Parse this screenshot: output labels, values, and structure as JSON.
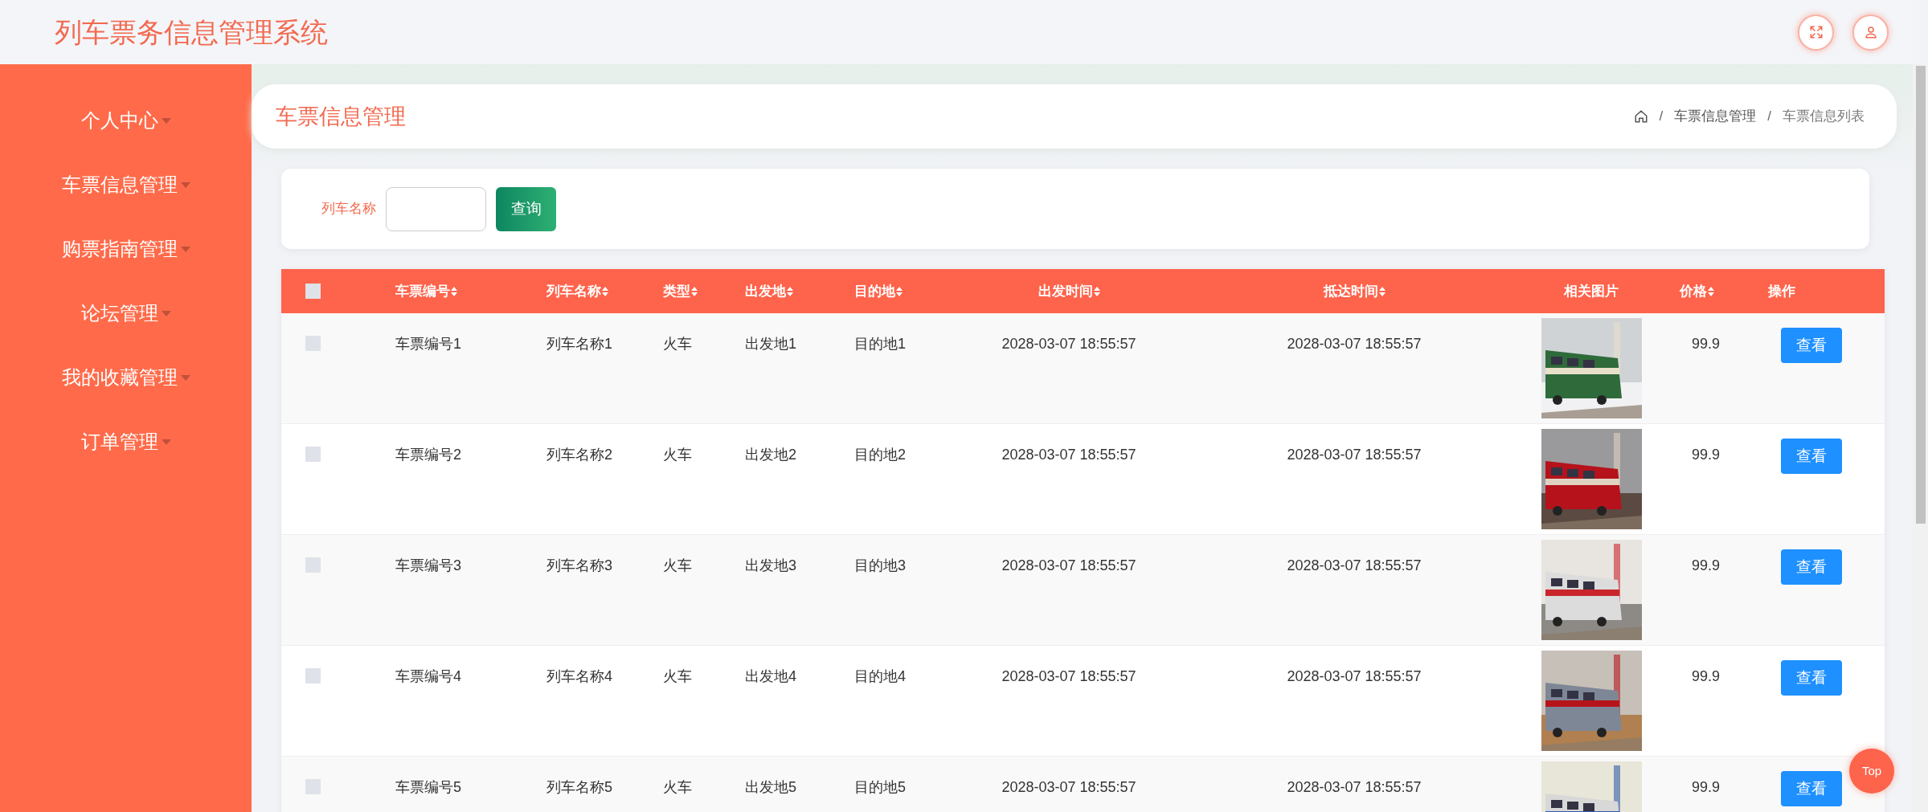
{
  "header": {
    "title": "列车票务信息管理系统"
  },
  "sidebar": {
    "items": [
      {
        "label": "个人中心",
        "expanded": false
      },
      {
        "label": "车票信息管理",
        "expanded": false
      },
      {
        "label": "购票指南管理",
        "expanded": false
      },
      {
        "label": "论坛管理",
        "expanded": false
      },
      {
        "label": "我的收藏管理",
        "expanded": false
      },
      {
        "label": "订单管理",
        "expanded": false
      }
    ]
  },
  "page_title": "车票信息管理",
  "breadcrumb": [
    {
      "kind": "home"
    },
    {
      "kind": "separator",
      "text": "/"
    },
    {
      "kind": "link",
      "text": "车票信息管理"
    },
    {
      "kind": "separator",
      "text": "/"
    },
    {
      "kind": "current",
      "text": "车票信息列表"
    }
  ],
  "search": {
    "label": "列车名称",
    "button": "查询"
  },
  "table": {
    "select_all": {
      "checked": false
    },
    "columns": [
      {
        "label": "车票编号",
        "sortable": true
      },
      {
        "label": "列车名称",
        "sortable": true
      },
      {
        "label": "类型",
        "sortable": true
      },
      {
        "label": "出发地",
        "sortable": true
      },
      {
        "label": "目的地",
        "sortable": true
      },
      {
        "label": "出发时间",
        "sortable": true
      },
      {
        "label": "抵达时间",
        "sortable": true
      },
      {
        "label": "相关图片",
        "sortable": false
      },
      {
        "label": "价格",
        "sortable": true
      },
      {
        "label": "操作",
        "sortable": false
      }
    ],
    "rows": [
      {
        "checked": false,
        "cells": [
          "车票编号1",
          "列车名称1",
          "火车",
          "出发地1",
          "目的地1",
          "2028-03-07 18:55:57",
          "2028-03-07 18:55:57"
        ],
        "price": "99.9",
        "action": "查看"
      },
      {
        "checked": false,
        "cells": [
          "车票编号2",
          "列车名称2",
          "火车",
          "出发地2",
          "目的地2",
          "2028-03-07 18:55:57",
          "2028-03-07 18:55:57"
        ],
        "price": "99.9",
        "action": "查看"
      },
      {
        "checked": false,
        "cells": [
          "车票编号3",
          "列车名称3",
          "火车",
          "出发地3",
          "目的地3",
          "2028-03-07 18:55:57",
          "2028-03-07 18:55:57"
        ],
        "price": "99.9",
        "action": "查看"
      },
      {
        "checked": false,
        "cells": [
          "车票编号4",
          "列车名称4",
          "火车",
          "出发地4",
          "目的地4",
          "2028-03-07 18:55:57",
          "2028-03-07 18:55:57"
        ],
        "price": "99.9",
        "action": "查看"
      },
      {
        "checked": false,
        "cells": [
          "车票编号5",
          "列车名称5",
          "火车",
          "出发地5",
          "目的地5",
          "2028-03-07 18:55:57",
          "2028-03-07 18:55:57"
        ],
        "price": "99.9",
        "action": "查看"
      }
    ]
  },
  "top_button": "Top"
}
